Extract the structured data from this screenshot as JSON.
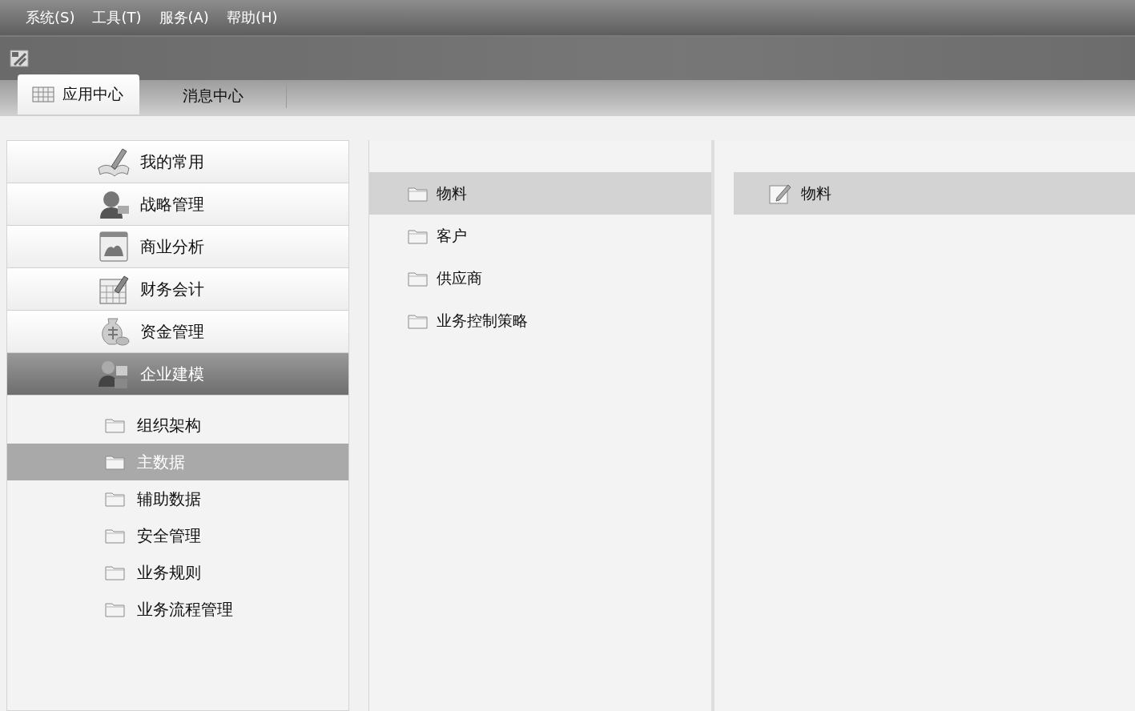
{
  "menu_bar": {
    "items": [
      {
        "label": "系统(S)"
      },
      {
        "label": "工具(T)"
      },
      {
        "label": "服务(A)"
      },
      {
        "label": "帮助(H)"
      }
    ]
  },
  "tabs": [
    {
      "label": "应用中心",
      "selected": true
    },
    {
      "label": "消息中心",
      "selected": false
    }
  ],
  "modules": [
    {
      "label": "我的常用",
      "selected": false
    },
    {
      "label": "战略管理",
      "selected": false
    },
    {
      "label": "商业分析",
      "selected": false
    },
    {
      "label": "财务会计",
      "selected": false
    },
    {
      "label": "资金管理",
      "selected": false
    },
    {
      "label": "企业建模",
      "selected": true
    }
  ],
  "module_items": [
    {
      "label": "组织架构",
      "selected": false
    },
    {
      "label": "主数据",
      "selected": true
    },
    {
      "label": "辅助数据",
      "selected": false
    },
    {
      "label": "安全管理",
      "selected": false
    },
    {
      "label": "业务规则",
      "selected": false
    },
    {
      "label": "业务流程管理",
      "selected": false
    }
  ],
  "folders": [
    {
      "label": "物料",
      "selected": true
    },
    {
      "label": "客户",
      "selected": false
    },
    {
      "label": "供应商",
      "selected": false
    },
    {
      "label": "业务控制策略",
      "selected": false
    }
  ],
  "functions": [
    {
      "label": "物料",
      "selected": true
    }
  ]
}
